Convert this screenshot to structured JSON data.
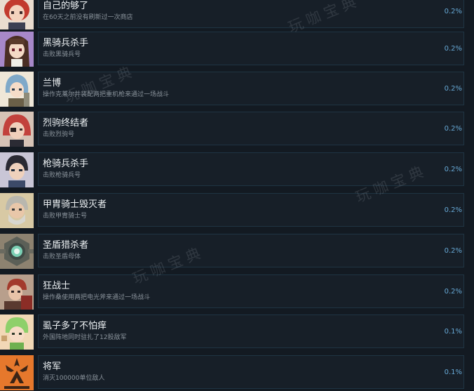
{
  "achievements": [
    {
      "title": "自己的够了",
      "desc": "在60天之前没有刷新过一次商店",
      "percent": "0.2%",
      "icon": "red-hair-girl-portrait-icon"
    },
    {
      "title": "黑骑兵杀手",
      "desc": "击败黑骑兵号",
      "percent": "0.2%",
      "icon": "brown-hair-girl-portrait-icon"
    },
    {
      "title": "兰博",
      "desc": "操作克莱尔并装配两把重机枪来通过一场战斗",
      "percent": "0.2%",
      "icon": "blue-hair-boy-portrait-icon"
    },
    {
      "title": "烈驹终结者",
      "desc": "击败烈驹号",
      "percent": "0.2%",
      "icon": "red-hair-woman-portrait-icon"
    },
    {
      "title": "枪骑兵杀手",
      "desc": "击败枪骑兵号",
      "percent": "0.2%",
      "icon": "dark-hair-man-portrait-icon"
    },
    {
      "title": "甲胄骑士毁灭者",
      "desc": "击败甲胄骑士号",
      "percent": "0.2%",
      "icon": "grey-beard-man-portrait-icon"
    },
    {
      "title": "圣盾猎杀者",
      "desc": "击败圣盾母体",
      "percent": "0.2%",
      "icon": "shield-mech-icon"
    },
    {
      "title": "狂战士",
      "desc": "操作桑使用两把电光斧来通过一场战斗",
      "percent": "0.2%",
      "icon": "warrior-portrait-icon"
    },
    {
      "title": "虱子多了不怕痒",
      "desc": "外国阵地同时驻扎了12股敌军",
      "percent": "0.1%",
      "icon": "green-hair-kid-portrait-icon"
    },
    {
      "title": "将军",
      "desc": "消灭100000单位敌人",
      "percent": "0.1%",
      "icon": "general-emblem-icon"
    }
  ],
  "watermark": "玩咖宝典",
  "colors": {
    "background": "#131a22",
    "card": "#171f28",
    "border": "#1f3443",
    "percent": "#67a9d6"
  }
}
